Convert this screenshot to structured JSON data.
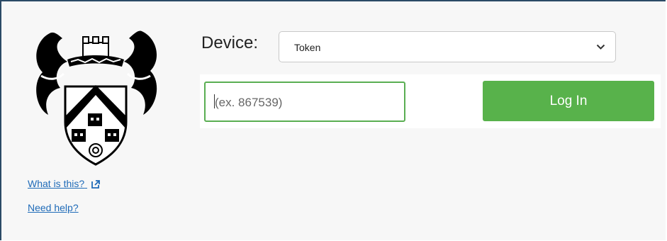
{
  "device": {
    "label": "Device:",
    "selected": "Token"
  },
  "passcode": {
    "placeholder": "(ex. 867539)"
  },
  "login_button": {
    "label": "Log In"
  },
  "links": {
    "what_is_this": "What is this?",
    "need_help": "Need help?"
  },
  "icons": {
    "external": "external-link-icon",
    "dropdown": "chevron-down-icon",
    "crest": "crest-logo"
  },
  "colors": {
    "accent_green": "#58b24b",
    "focus_border": "#5aae52",
    "link": "#1f6bb8"
  }
}
